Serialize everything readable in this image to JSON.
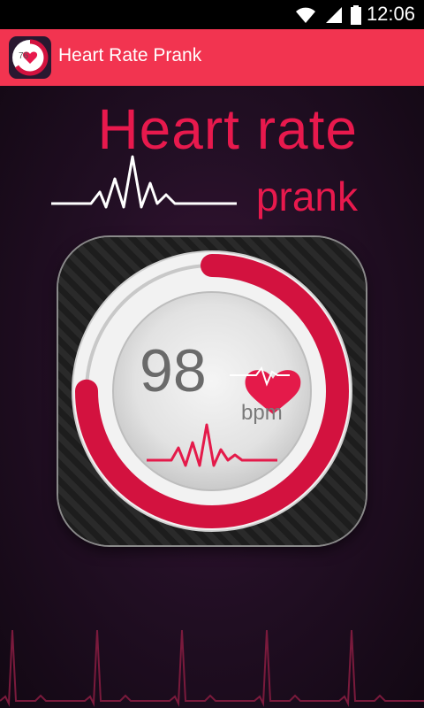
{
  "status_bar": {
    "time": "12:06"
  },
  "app": {
    "title": "Heart Rate Prank"
  },
  "header": {
    "line1": "Heart rate",
    "line2": "prank"
  },
  "gauge": {
    "bpm": "98",
    "unit": "bpm",
    "level": 0.75
  },
  "colors": {
    "accent": "#f23450",
    "title": "#e8194d",
    "ring": "#d3123f"
  }
}
